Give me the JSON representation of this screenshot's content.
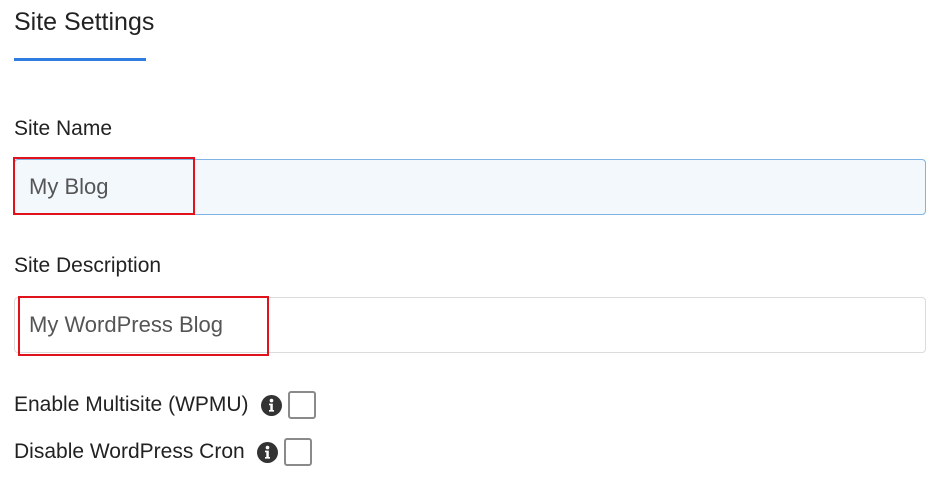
{
  "section": {
    "title": "Site Settings",
    "accent_color": "#2f7de1"
  },
  "site_name": {
    "label": "Site Name",
    "value": "My Blog"
  },
  "site_description": {
    "label": "Site Description",
    "value": "My WordPress Blog"
  },
  "options": [
    {
      "label": "Enable Multisite (WPMU)",
      "icon": "info-icon",
      "checked": false
    },
    {
      "label": "Disable WordPress Cron",
      "icon": "info-icon",
      "checked": false
    }
  ],
  "highlight_color": "#e0121b"
}
